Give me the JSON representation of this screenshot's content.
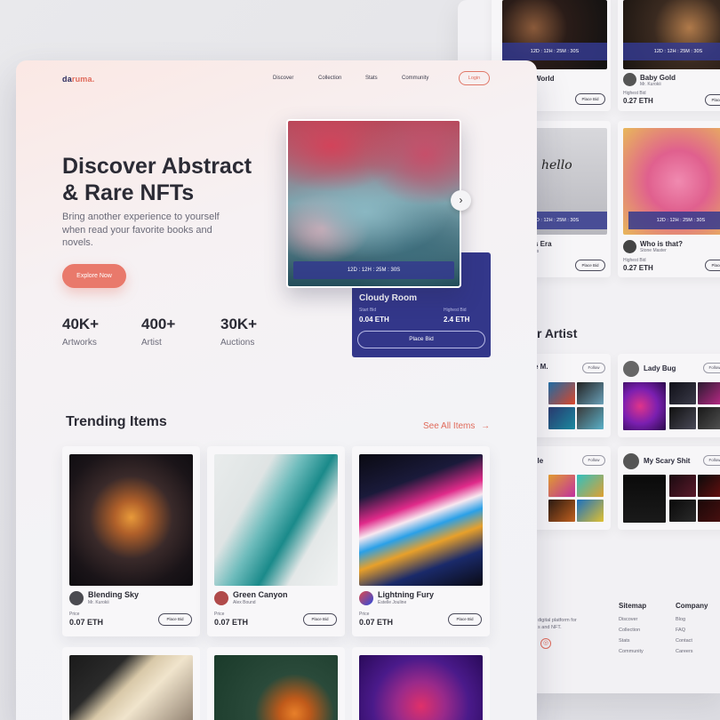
{
  "nav": {
    "logo_a": "da",
    "logo_b": "ruma.",
    "items": [
      "Discover",
      "Collection",
      "Stats",
      "Community"
    ],
    "login": "Login"
  },
  "hero": {
    "title_line1": "Discover Abstract",
    "title_line2": "& Rare NFTs",
    "subtitle": "Bring another experience to yourself when read your favorite books and novels.",
    "cta": "Explore Now",
    "stats": [
      {
        "value": "40K+",
        "label": "Artworks"
      },
      {
        "value": "400+",
        "label": "Artist"
      },
      {
        "value": "30K+",
        "label": "Auctions"
      }
    ],
    "timer": "12D : 12H : 25M : 30S",
    "next_icon": "›",
    "bid": {
      "title": "Cloudy Room",
      "start_label": "Start Bid",
      "start_value": "0.04 ETH",
      "high_label": "Highest Bid",
      "high_value": "2.4 ETH",
      "button": "Place Bid"
    }
  },
  "trending": {
    "title": "Trending Items",
    "see_all": "See All Items",
    "arrow": "→",
    "price_label": "Price",
    "bid_label": "Place Bid",
    "items": [
      {
        "name": "Blending Sky",
        "author": "Mr. Kurokii",
        "price": "0.07 ETH"
      },
      {
        "name": "Green Canyon",
        "author": "Alex Bound",
        "price": "0.07 ETH"
      },
      {
        "name": "Lightning Fury",
        "author": "Estelle Jouline",
        "price": "0.07 ETH"
      }
    ]
  },
  "back": {
    "timer": "12D : 12H : 25M : 30S",
    "bid_label": "Place Bid",
    "highest_bid_label": "Highest Bid",
    "cards_top": [
      {
        "name": "World",
        "author": "",
        "price": ""
      },
      {
        "name": "Baby Gold",
        "author": "Mr. Kurokii",
        "price": "0.27 ETH"
      }
    ],
    "cards_mid": [
      {
        "name": "s Era",
        "author": "ris",
        "price": ""
      },
      {
        "name": "Who is that?",
        "author": "Stone Master",
        "price": "0.27 ETH"
      }
    ],
    "hello_text": "hello",
    "artist_heading": "r Artist",
    "follow_label": "Follow",
    "artists": [
      {
        "name": "rge M."
      },
      {
        "name": "Lady Bug"
      },
      {
        "name": "uelle"
      },
      {
        "name": "My Scary Shit"
      }
    ],
    "footer": {
      "blurb_line1": "digital platform for",
      "blurb_line2": "s and NFT.",
      "instagram_icon": "◎",
      "sitemap_heading": "Sitemap",
      "sitemap": [
        "Discover",
        "Collection",
        "Stats",
        "Community"
      ],
      "company_heading": "Company",
      "company": [
        "Blog",
        "FAQ",
        "Contact",
        "Careers"
      ]
    }
  }
}
